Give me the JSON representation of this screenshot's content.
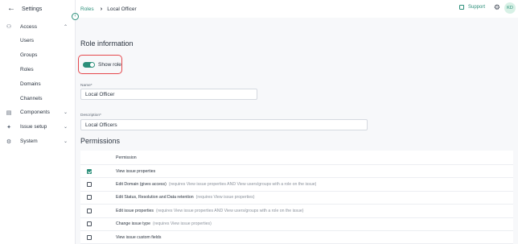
{
  "sidebar": {
    "back_label": "Settings",
    "groups": [
      {
        "label": "Access",
        "icon": "users-icon"
      },
      {
        "label": "Components",
        "icon": "database-icon"
      },
      {
        "label": "Issue setup",
        "icon": "wrench-icon"
      },
      {
        "label": "System",
        "icon": "gear-icon"
      }
    ],
    "access_items": [
      "Users",
      "Groups",
      "Roles",
      "Domains",
      "Channels"
    ]
  },
  "header": {
    "breadcrumb_parent": "Roles",
    "breadcrumb_current": "Local Officer",
    "support_label": "Support",
    "avatar_initials": "KD"
  },
  "main": {
    "section_title": "Role information",
    "show_role_label": "Show role",
    "show_role_enabled": true,
    "name_label": "Name*",
    "name_value": "Local Officer",
    "description_label": "Description*",
    "description_value": "Local Officers",
    "permissions_title": "Permissions",
    "permission_header": "Permission",
    "permissions": [
      {
        "name": "View issue properties",
        "note": "",
        "checked": true
      },
      {
        "name": "Edit Domain (gives access)",
        "note": "(requires View issue properties AND View users/groups with a role on the issue)",
        "checked": false
      },
      {
        "name": "Edit Status, Resolution and Data retention",
        "note": "(requires View issue properties)",
        "checked": false
      },
      {
        "name": "Edit issue properties",
        "note": "(requires View issue properties AND View users/groups with a role on the issue)",
        "checked": false
      },
      {
        "name": "Change issue type",
        "note": "(requires View issue properties)",
        "checked": false
      },
      {
        "name": "View issue custom fields",
        "note": "",
        "checked": false
      }
    ]
  },
  "colors": {
    "accent": "#2c8f7a",
    "highlight_border": "#e5484d",
    "background": "#f7f8fa"
  }
}
